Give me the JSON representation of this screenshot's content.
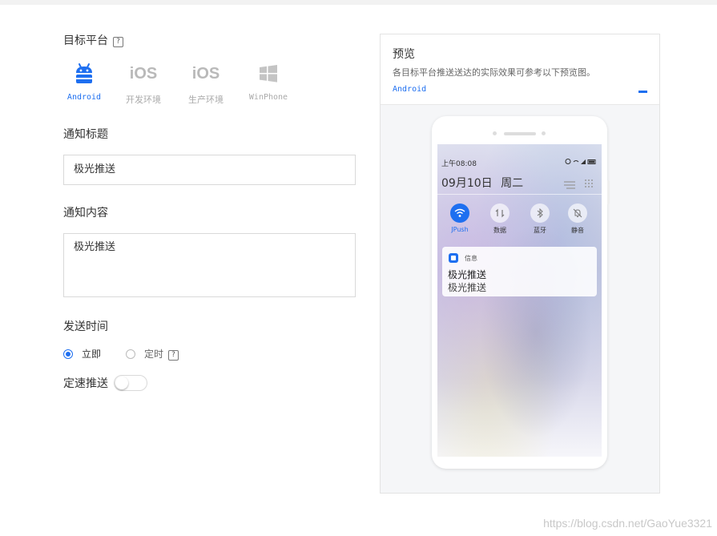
{
  "form": {
    "platform_label": "目标平台",
    "help_glyph": "?",
    "platforms": [
      {
        "name": "Android",
        "icon": "android-icon",
        "active": true
      },
      {
        "name": "开发环境",
        "icon": "ios-icon",
        "icon_text": "iOS",
        "active": false
      },
      {
        "name": "生产环境",
        "icon": "ios-icon",
        "icon_text": "iOS",
        "active": false
      },
      {
        "name": "WinPhone",
        "icon": "windows-icon",
        "active": false
      }
    ],
    "title_label": "通知标题",
    "title_value": "极光推送",
    "content_label": "通知内容",
    "content_value": "极光推送",
    "send_time_label": "发送时间",
    "send_now": "立即",
    "send_scheduled": "定时",
    "rate_push_label": "定速推送",
    "rate_push_on": false
  },
  "preview": {
    "title": "预览",
    "description": "各目标平台推送送达的实际效果可参考以下预览图。",
    "platform": "Android",
    "collapse_glyph": "–",
    "phone": {
      "time": "上午08:08",
      "date": "09月10日",
      "weekday": "周二",
      "quick_settings": [
        {
          "label": "JPush",
          "icon": "wifi-icon",
          "active": true
        },
        {
          "label": "数据",
          "icon": "data-icon",
          "active": false
        },
        {
          "label": "蓝牙",
          "icon": "bluetooth-icon",
          "active": false
        },
        {
          "label": "静音",
          "icon": "bell-mute-icon",
          "active": false
        }
      ],
      "notification": {
        "app": "信息",
        "title": "极光推送",
        "body": "极光推送"
      }
    }
  },
  "watermark": "https://blog.csdn.net/GaoYue3321",
  "colors": {
    "accent": "#1e6ff0",
    "muted": "#b9b9b9"
  }
}
